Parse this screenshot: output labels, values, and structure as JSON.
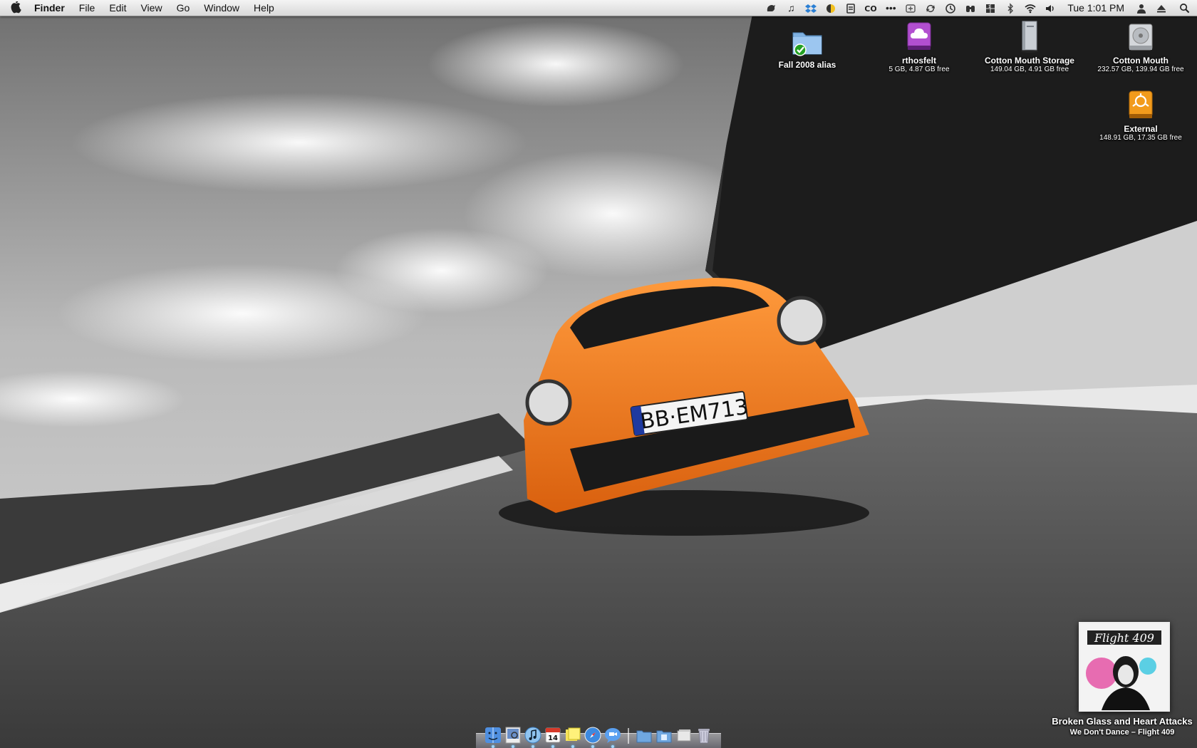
{
  "menubar": {
    "app": "Finder",
    "menus": [
      "File",
      "Edit",
      "View",
      "Go",
      "Window",
      "Help"
    ],
    "status_icons": [
      "growl-icon",
      "itunes-note-icon",
      "dropbox-icon",
      "coconut-battery-icon",
      "script-icon",
      "creative-suite-icon",
      "more-dots-icon",
      "expose-icon",
      "sync-icon",
      "time-machine-icon",
      "binoculars-icon",
      "spaces-icon",
      "bluetooth-icon",
      "wifi-icon",
      "volume-icon"
    ],
    "clock": "Tue 1:01 PM"
  },
  "desktop_icons": [
    {
      "name": "Fall 2008 alias",
      "info": "",
      "icon": "folder-alias-icon"
    },
    {
      "name": "rthosfelt",
      "info": "5 GB, 4.87 GB free",
      "icon": "idisk-icon"
    },
    {
      "name": "Cotton Mouth Storage",
      "info": "149.04 GB, 4.91 GB free",
      "icon": "server-drive-icon"
    },
    {
      "name": "Cotton Mouth",
      "info": "232.57 GB, 139.94 GB free",
      "icon": "hard-drive-icon"
    },
    {
      "name": "External",
      "info": "148.91 GB, 17.35 GB free",
      "icon": "firewire-drive-icon"
    }
  ],
  "now_playing": {
    "song": "Broken Glass and Heart Attacks",
    "artist_album": "We Don't Dance – Flight 409",
    "album_art_text": "Flight 409"
  },
  "wallpaper": {
    "plate": "BB·EM713",
    "car_color": "#f07a1c"
  },
  "dock": {
    "apps": [
      "finder-icon",
      "preview-icon",
      "itunes-icon",
      "ical-icon",
      "stickies-icon",
      "safari-icon",
      "ichat-icon"
    ],
    "calendar_day": "14",
    "others": [
      "applications-folder-icon",
      "documents-folder-icon",
      "downloads-stack-icon",
      "trash-icon"
    ]
  }
}
